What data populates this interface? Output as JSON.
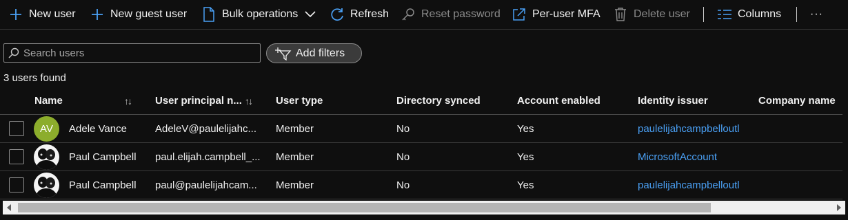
{
  "toolbar": {
    "new_user": "New user",
    "new_guest_user": "New guest user",
    "bulk_operations": "Bulk operations",
    "refresh": "Refresh",
    "reset_password": "Reset password",
    "per_user_mfa": "Per-user MFA",
    "delete_user": "Delete user",
    "columns": "Columns",
    "more": "···"
  },
  "search": {
    "placeholder": "Search users",
    "value": ""
  },
  "filters": {
    "label": "Add filters"
  },
  "results": {
    "count_text": "3 users found"
  },
  "table": {
    "headers": {
      "name": "Name",
      "upn": "User principal n...",
      "user_type": "User type",
      "directory_synced": "Directory synced",
      "account_enabled": "Account enabled",
      "identity_issuer": "Identity issuer",
      "company_name": "Company name"
    },
    "sort_glyph": "↑↓",
    "rows": [
      {
        "initials": "AV",
        "avatar_type": "initials",
        "name": "Adele Vance",
        "upn": "AdeleV@paulelijahc...",
        "user_type": "Member",
        "directory_synced": "No",
        "account_enabled": "Yes",
        "identity_issuer": "paulelijahcampbelloutl",
        "company_name": ""
      },
      {
        "initials": "",
        "avatar_type": "photo",
        "name": "Paul Campbell",
        "upn": "paul.elijah.campbell_...",
        "user_type": "Member",
        "directory_synced": "No",
        "account_enabled": "Yes",
        "identity_issuer": "MicrosoftAccount",
        "company_name": ""
      },
      {
        "initials": "",
        "avatar_type": "photo",
        "name": "Paul Campbell",
        "upn": "paul@paulelijahcam...",
        "user_type": "Member",
        "directory_synced": "No",
        "account_enabled": "Yes",
        "identity_issuer": "paulelijahcampbelloutl",
        "company_name": ""
      }
    ]
  },
  "colors": {
    "accent": "#4aa0f5",
    "avatar_initials_bg": "#8cad2c",
    "background": "#0f0f0f"
  }
}
